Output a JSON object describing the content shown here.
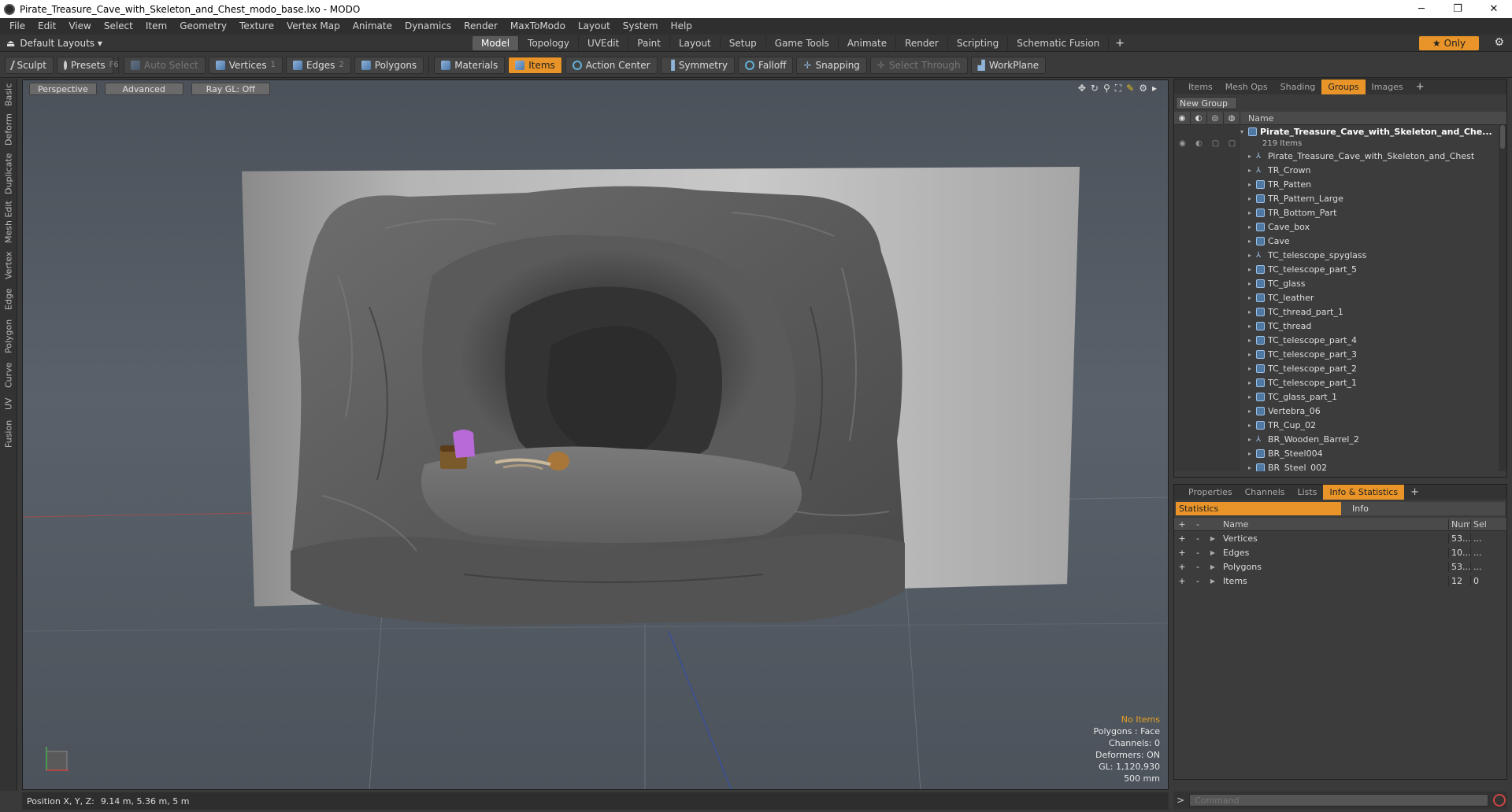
{
  "window": {
    "title": "Pirate_Treasure_Cave_with_Skeleton_and_Chest_modo_base.lxo - MODO",
    "minimize": "─",
    "maximize": "❐",
    "close": "✕"
  },
  "menu": [
    "File",
    "Edit",
    "View",
    "Select",
    "Item",
    "Geometry",
    "Texture",
    "Vertex Map",
    "Animate",
    "Dynamics",
    "Render",
    "MaxToModo",
    "Layout",
    "System",
    "Help"
  ],
  "layoutbar": {
    "layout_name": "Default Layouts ▾",
    "tabs": [
      "Model",
      "Topology",
      "UVEdit",
      "Paint",
      "Layout",
      "Setup",
      "Game Tools",
      "Animate",
      "Render",
      "Scripting",
      "Schematic Fusion"
    ],
    "active_tab": "Model",
    "plus": "+",
    "only_label": "Only",
    "star": "★"
  },
  "toolbar": {
    "sculpt": "Sculpt",
    "presets": "Presets",
    "presets_key": "F6",
    "auto_select": "Auto Select",
    "vertices": "Vertices",
    "vertices_key": "1",
    "edges": "Edges",
    "edges_key": "2",
    "polygons": "Polygons",
    "materials": "Materials",
    "items": "Items",
    "action_center": "Action Center",
    "symmetry": "Symmetry",
    "falloff": "Falloff",
    "snapping": "Snapping",
    "select_through": "Select Through",
    "workplane": "WorkPlane"
  },
  "lefttabs": [
    "Basic",
    "Deform",
    "Duplicate",
    "Mesh Edit",
    "Vertex",
    "Edge",
    "Polygon",
    "Curve",
    "UV",
    "Fusion"
  ],
  "viewport": {
    "view_mode": "Perspective",
    "shading": "Advanced",
    "raygl": "Ray GL: Off",
    "info": {
      "selection": "No Items",
      "polygons": "Polygons : Face",
      "channels": "Channels: 0",
      "deformers": "Deformers: ON",
      "gl": "GL: 1,120,930",
      "scale": "500 mm"
    }
  },
  "statusbar": {
    "label": "Position X, Y, Z:",
    "value": "9.14 m, 5.36 m, 5 m"
  },
  "groups_panel": {
    "tabs": [
      "Items",
      "Mesh Ops",
      "Shading",
      "Groups",
      "Images"
    ],
    "active_tab": "Groups",
    "plus": "+",
    "new_group": "New Group",
    "name_header": "Name",
    "root_name": "Pirate_Treasure_Cave_with_Skeleton_and_Che...",
    "root_count": "219 Items",
    "items": [
      {
        "name": "Pirate_Treasure_Cave_with_Skeleton_and_Chest",
        "type": "locator"
      },
      {
        "name": "TR_Crown",
        "type": "locator"
      },
      {
        "name": "TR_Patten",
        "type": "mesh"
      },
      {
        "name": "TR_Pattern_Large",
        "type": "mesh"
      },
      {
        "name": "TR_Bottom_Part",
        "type": "mesh"
      },
      {
        "name": "Cave_box",
        "type": "mesh"
      },
      {
        "name": "Cave",
        "type": "mesh"
      },
      {
        "name": "TC_telescope_spyglass",
        "type": "locator"
      },
      {
        "name": "TC_telescope_part_5",
        "type": "mesh"
      },
      {
        "name": "TC_glass",
        "type": "mesh"
      },
      {
        "name": "TC_leather",
        "type": "mesh"
      },
      {
        "name": "TC_thread_part_1",
        "type": "mesh"
      },
      {
        "name": "TC_thread",
        "type": "mesh"
      },
      {
        "name": "TC_telescope_part_4",
        "type": "mesh"
      },
      {
        "name": "TC_telescope_part_3",
        "type": "mesh"
      },
      {
        "name": "TC_telescope_part_2",
        "type": "mesh"
      },
      {
        "name": "TC_telescope_part_1",
        "type": "mesh"
      },
      {
        "name": "TC_glass_part_1",
        "type": "mesh"
      },
      {
        "name": "Vertebra_06",
        "type": "mesh"
      },
      {
        "name": "TR_Cup_02",
        "type": "mesh"
      },
      {
        "name": "BR_Wooden_Barrel_2",
        "type": "locator"
      },
      {
        "name": "BR_Steel004",
        "type": "mesh"
      },
      {
        "name": "BR_Steel_002",
        "type": "mesh"
      }
    ]
  },
  "stats_panel": {
    "tabs": [
      "Properties",
      "Channels",
      "Lists",
      "Info & Statistics"
    ],
    "active_tab": "Info & Statistics",
    "plus": "+",
    "subtab_statistics": "Statistics",
    "subtab_info": "Info",
    "headers": {
      "name": "Name",
      "num": "Num",
      "sel": "Sel"
    },
    "rows": [
      {
        "name": "Vertices",
        "num": "53...",
        "sel": "..."
      },
      {
        "name": "Edges",
        "num": "10...",
        "sel": "..."
      },
      {
        "name": "Polygons",
        "num": "53...",
        "sel": "..."
      },
      {
        "name": "Items",
        "num": "12",
        "sel": "0"
      }
    ]
  },
  "command": {
    "prompt": ">",
    "placeholder": "Command"
  },
  "colors": {
    "accent": "#e89428",
    "panel_bg": "#3c3c3c",
    "viewport_bg": "#555c64"
  }
}
